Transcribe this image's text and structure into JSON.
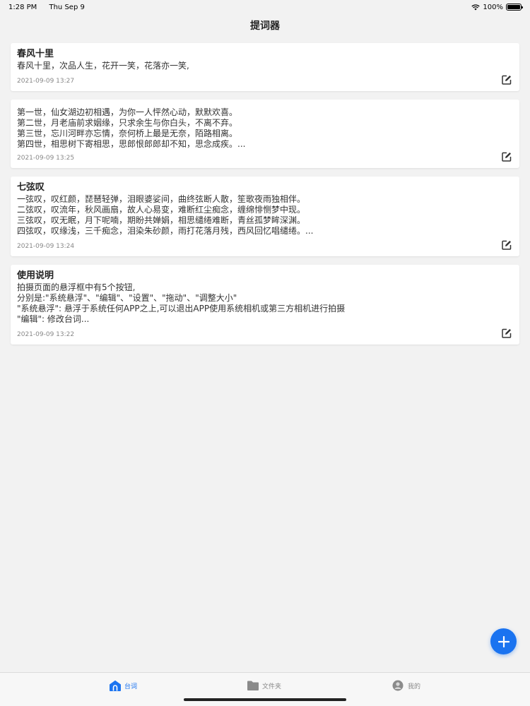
{
  "status_bar": {
    "time": "1:28 PM",
    "date": "Thu Sep 9",
    "battery": "100%"
  },
  "nav": {
    "title": "提词器"
  },
  "cards": [
    {
      "title": "春风十里",
      "body": "春风十里，次品人生，花开一笑，花落亦一笑,",
      "date": "2021-09-09 13:27"
    },
    {
      "title": "",
      "body": "第一世，仙女湖边初相遇，为你一人怦然心动，默默欢喜。\n第二世，月老庙前求姻缘，只求余生与你白头，不离不弃。\n第三世，忘川河畔亦忘情，奈何桥上最是无奈，陌路相离。\n第四世，相思树下寄相思，思郎恨郎郎却不知，思念成疾。...",
      "date": "2021-09-09 13:25"
    },
    {
      "title": "七弦叹",
      "body": "一弦叹，叹红颜，琵琶轻弹，泪眼婆娑间，曲终弦断人散，笙歌夜雨独相伴。\n二弦叹，叹流年，秋风画扇，故人心易变，难断红尘痴念，缠绵悱恻梦中现。\n三弦叹，叹无眠，月下呢喃，期盼共婵娟，相思缱绻难断，青丝孤梦眸深渊。\n四弦叹，叹缘浅，三千痴念，泪染朱砂颜，雨打花落月残，西风回忆唱缱绻。...",
      "date": "2021-09-09 13:24"
    },
    {
      "title": "使用说明",
      "body": "拍摄页面的悬浮框中有5个按钮,\n分别是:\"系统悬浮\"、\"编辑\"、\"设置\"、\"拖动\"、\"调整大小\"\n\"系统悬浮\": 悬浮于系统任何APP之上,可以退出APP使用系统相机或第三方相机进行拍摄\n\"编辑\": 修改台词...",
      "date": "2021-09-09 13:22"
    }
  ],
  "tabs": [
    {
      "label": "台词",
      "icon": "home-icon",
      "active": true
    },
    {
      "label": "文件夹",
      "icon": "folder-icon",
      "active": false
    },
    {
      "label": "我的",
      "icon": "profile-icon",
      "active": false
    }
  ],
  "colors": {
    "accent": "#1a73f0",
    "background": "#f2f2f2",
    "card": "#ffffff"
  }
}
